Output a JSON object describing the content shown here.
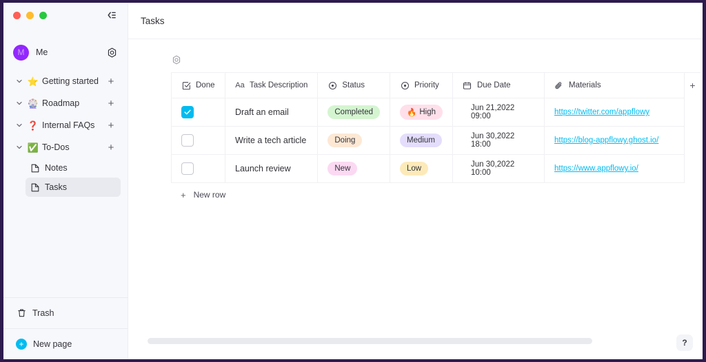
{
  "window": {
    "traffic_lights": [
      "close",
      "minimize",
      "maximize"
    ],
    "collapse_icon": "collapse-sidebar-icon"
  },
  "sidebar": {
    "user": {
      "avatar_letter": "M",
      "name": "Me",
      "settings_icon": "gear-icon",
      "avatar_color": "#9327ff"
    },
    "sections": [
      {
        "emoji": "⭐",
        "label": "Getting started",
        "add_label": "+",
        "expanded": true
      },
      {
        "emoji": "🎡",
        "label": "Roadmap",
        "add_label": "+",
        "expanded": true
      },
      {
        "emoji": "❓",
        "label": "Internal FAQs",
        "add_label": "+",
        "expanded": true
      },
      {
        "emoji": "✅",
        "label": "To-Dos",
        "add_label": "+",
        "expanded": true
      }
    ],
    "pages": [
      {
        "label": "Notes",
        "selected": false
      },
      {
        "label": "Tasks",
        "selected": true
      }
    ],
    "trash_label": "Trash",
    "new_page_label": "New page",
    "new_page_plus": "+"
  },
  "topbar": {
    "title": "Tasks"
  },
  "grid": {
    "settings_icon": "grid-settings-icon",
    "add_column_label": "+",
    "new_row_label": "New row",
    "new_row_plus": "+",
    "columns": [
      {
        "label": "Done",
        "icon": "checkbox-icon"
      },
      {
        "label": "Task Description",
        "icon": "text-aa-icon"
      },
      {
        "label": "Status",
        "icon": "single-select-icon"
      },
      {
        "label": "Priority",
        "icon": "single-select-icon"
      },
      {
        "label": "Due Date",
        "icon": "calendar-icon"
      },
      {
        "label": "Materials",
        "icon": "paperclip-icon"
      }
    ],
    "rows": [
      {
        "done": true,
        "task": "Draft an email",
        "status": {
          "label": "Completed",
          "bg": "#d4f5d0"
        },
        "priority": {
          "label": "High",
          "emoji": "🔥",
          "bg": "#ffe0ea"
        },
        "date": "Jun 21,2022  09:00",
        "material": "https://twitter.com/appflowy"
      },
      {
        "done": false,
        "task": "Write a tech article",
        "status": {
          "label": "Doing",
          "bg": "#fde8d4"
        },
        "priority": {
          "label": "Medium",
          "emoji": "",
          "bg": "#e4ddfb"
        },
        "date": "Jun 30,2022  18:00",
        "material": "https://blog-appflowy.ghost.io/"
      },
      {
        "done": false,
        "task": "Launch review",
        "status": {
          "label": "New",
          "bg": "#fbd9f2"
        },
        "priority": {
          "label": "Low",
          "emoji": "",
          "bg": "#fdeab9"
        },
        "date": "Jun 30,2022  10:00",
        "material": "https://www.appflowy.io/"
      }
    ]
  },
  "footer": {
    "help_label": "?",
    "scrollbar": "horizontal-scrollbar"
  },
  "colors": {
    "accent": "#00bcf0",
    "frame": "#2d1b4e",
    "sidebar_bg": "#f7f8fc"
  }
}
